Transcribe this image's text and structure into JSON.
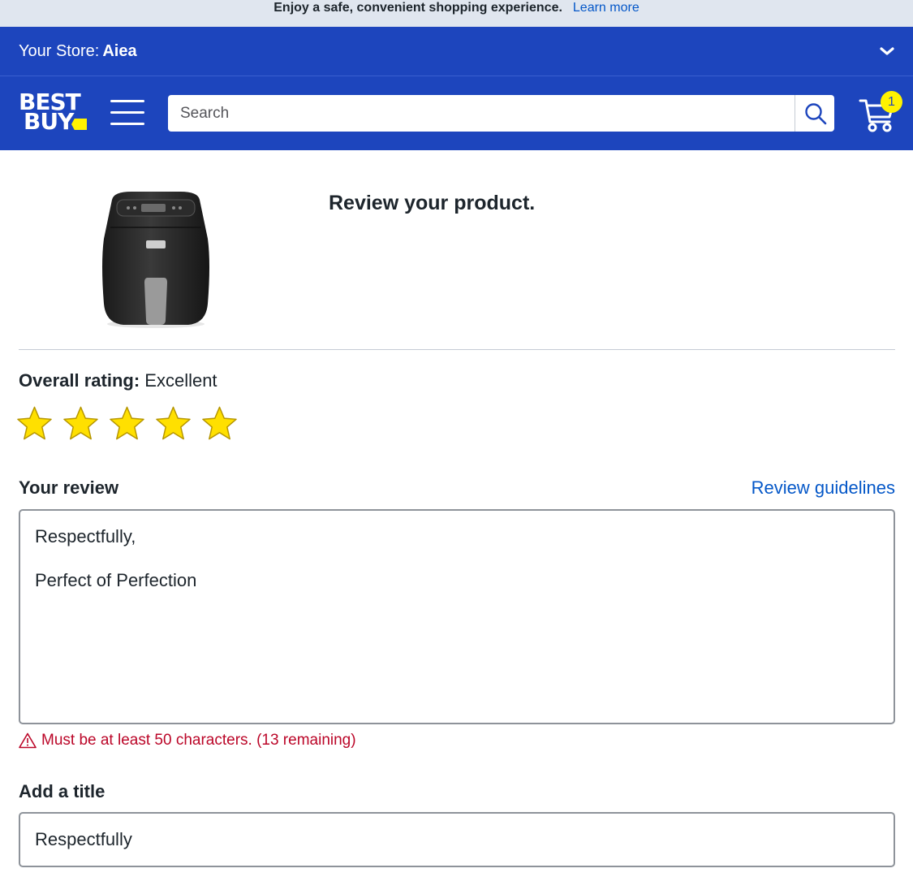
{
  "promo": {
    "message": "Enjoy a safe, convenient shopping experience.",
    "link": "Learn more"
  },
  "store": {
    "prefix": "Your Store:",
    "name": "Aiea"
  },
  "header": {
    "logo_line1": "BEST",
    "logo_line2": "BUY",
    "search_placeholder": "Search",
    "cart_count": "1",
    "brand_color": "#1d45bd",
    "accent_color": "#fff200"
  },
  "product": {
    "heading": "Review your product.",
    "image": "air-fryer-product-image"
  },
  "rating": {
    "label": "Overall rating:",
    "value": "Excellent",
    "stars": 5,
    "max": 5
  },
  "review": {
    "label": "Your review",
    "guidelines_link": "Review guidelines",
    "line1": "Respectfully,",
    "line2": "Perfect of Perfection",
    "error": "Must be at least 50 characters. (13 remaining)",
    "error_color": "#bb0628"
  },
  "title": {
    "label": "Add a title",
    "value": "Respectfully"
  }
}
